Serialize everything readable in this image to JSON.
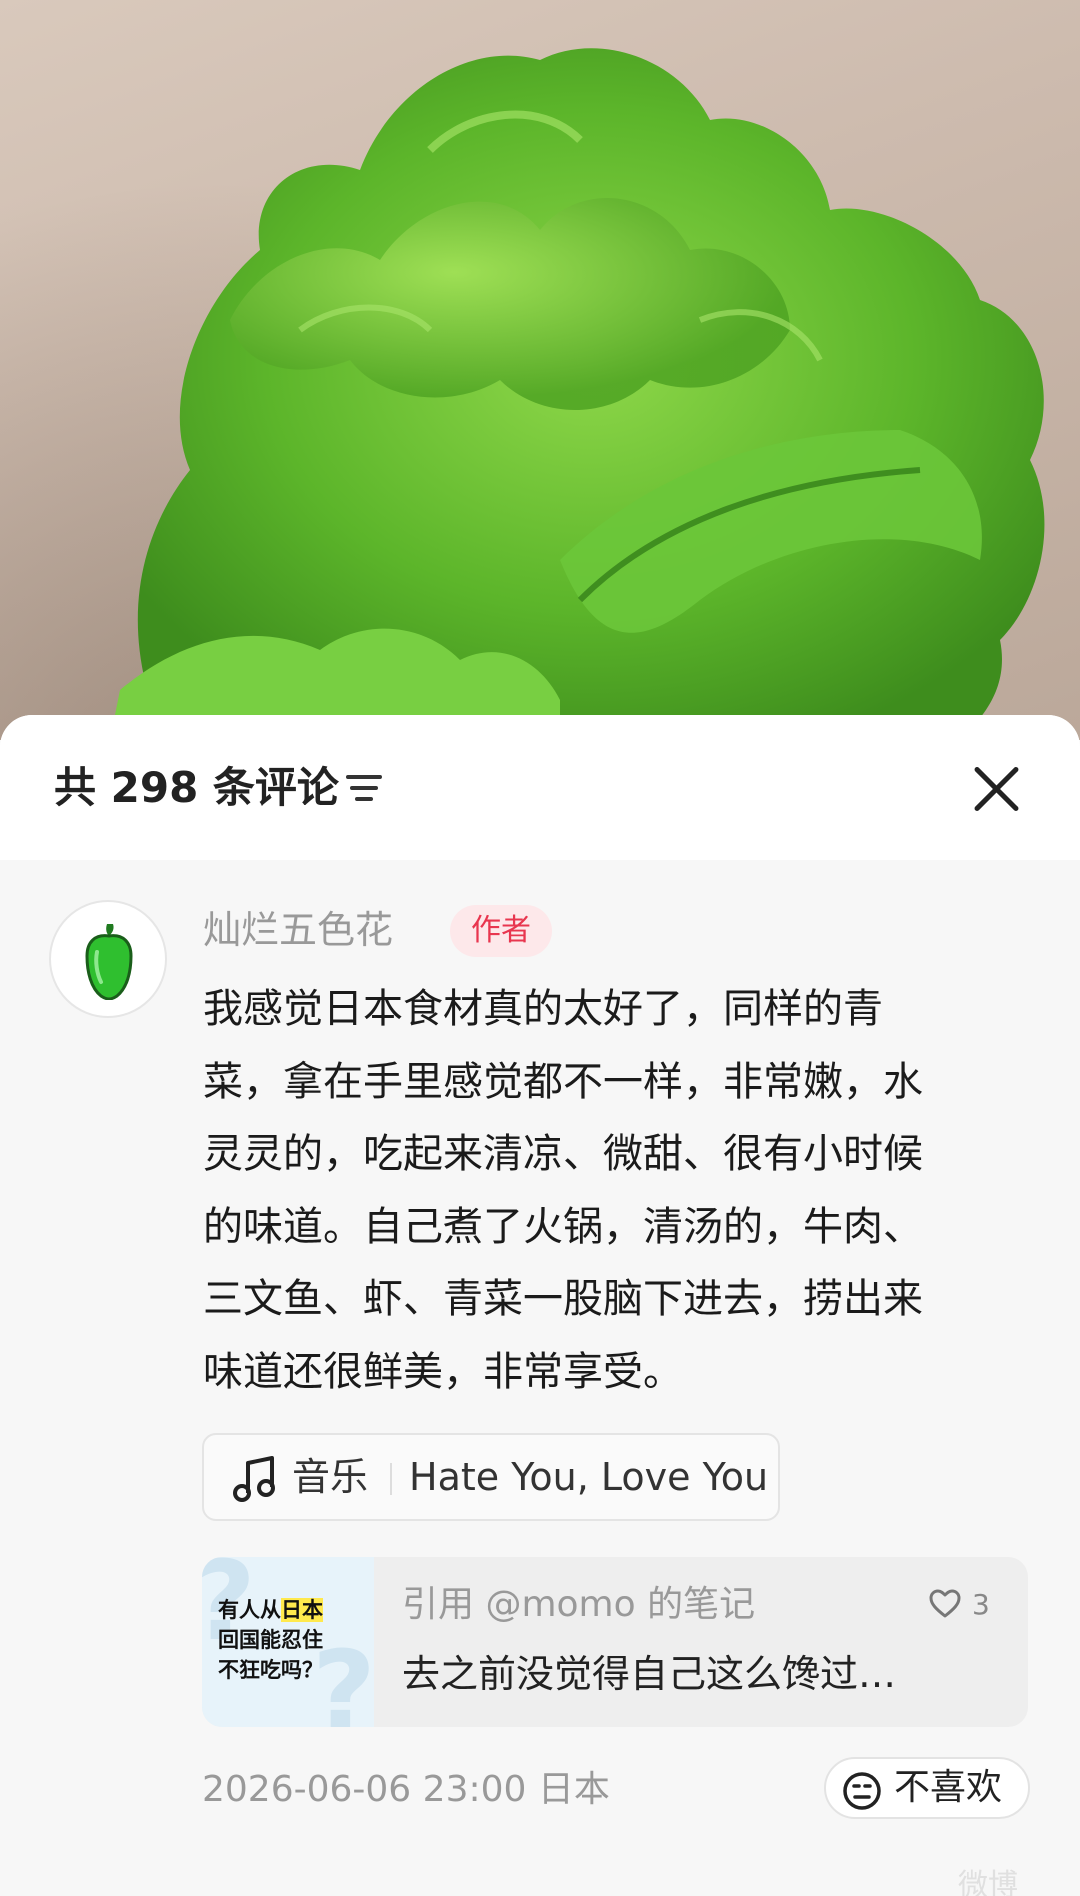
{
  "header": {
    "count_title": "共 298 条评论"
  },
  "comment": {
    "username": "灿烂五色花",
    "badge": "作者",
    "lines": [
      "我感觉日本食材真的太好了，同样的青",
      "菜，拿在手里感觉都不一样，非常嫩，水",
      "灵灵的，吃起来清凉、微甜、很有小时候",
      "的味道。自己煮了火锅，清汤的，牛肉、",
      "三文鱼、虾、青菜一股脑下进去，捞出来",
      "味道还很鲜美，非常享受。"
    ],
    "music": {
      "label": "音乐",
      "title": "Hate You, Love You"
    },
    "quote": {
      "thumb_line1_pre": "有人从",
      "thumb_line1_hl": "日本",
      "thumb_line2": "回国能忍住",
      "thumb_line3": "不狂吃吗？",
      "source": "引用 @momo 的笔记",
      "likes": "3",
      "snippet": "去之前没觉得自己这么馋过…"
    },
    "meta": "2026-06-06 23:00  日本",
    "dislike_label": "不喜欢"
  },
  "watermark": "微博",
  "colors": {
    "badge_bg": "#fde8ea",
    "badge_text": "#e8364f",
    "pepper": "#2fbf2f",
    "lettuce": "#5fb52c"
  },
  "icons": [
    "sort-icon",
    "close-icon",
    "pepper-avatar-icon",
    "music-note-icon",
    "heart-icon",
    "neutral-face-icon"
  ]
}
